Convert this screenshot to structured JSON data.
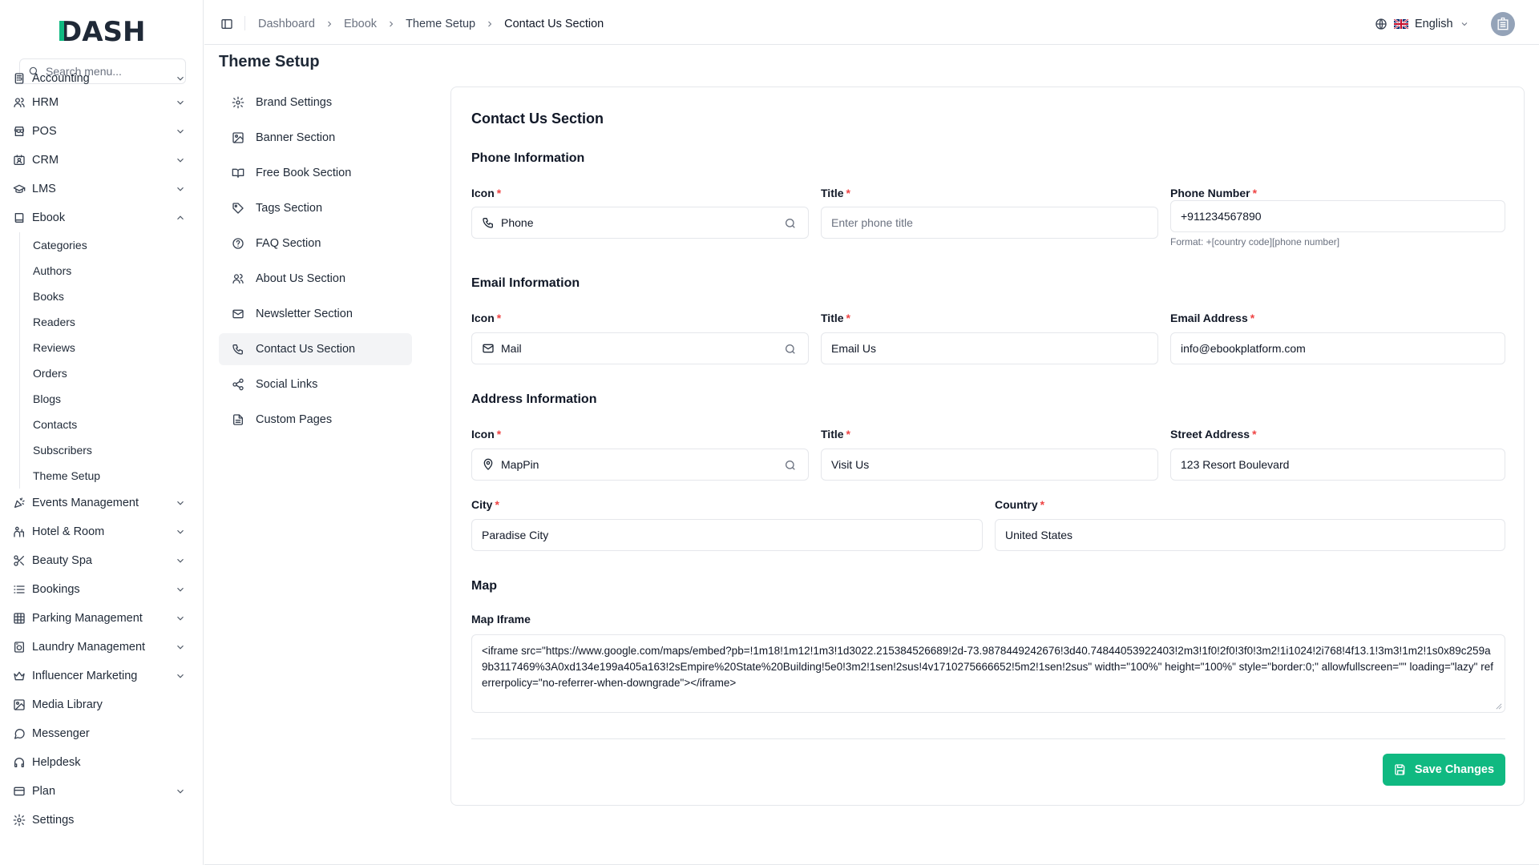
{
  "app": {
    "logo_text": "DASH"
  },
  "sidebar": {
    "search_placeholder": "Search menu...",
    "items": [
      {
        "label": "Accounting",
        "icon": "calculator-icon",
        "expandable": true
      },
      {
        "label": "HRM",
        "icon": "users-icon",
        "expandable": true
      },
      {
        "label": "POS",
        "icon": "store-icon",
        "expandable": true
      },
      {
        "label": "CRM",
        "icon": "contact-card-icon",
        "expandable": true
      },
      {
        "label": "LMS",
        "icon": "graduation-cap-icon",
        "expandable": true
      },
      {
        "label": "Ebook",
        "icon": "book-icon",
        "expandable": true,
        "expanded": true
      },
      {
        "label": "Events Management",
        "icon": "party-popper-icon",
        "expandable": true
      },
      {
        "label": "Hotel & Room",
        "icon": "hotel-icon",
        "expandable": true
      },
      {
        "label": "Beauty Spa",
        "icon": "scissors-icon",
        "expandable": true
      },
      {
        "label": "Bookings",
        "icon": "list-icon",
        "expandable": true
      },
      {
        "label": "Parking Management",
        "icon": "grid-icon",
        "expandable": true
      },
      {
        "label": "Laundry Management",
        "icon": "washing-machine-icon",
        "expandable": true
      },
      {
        "label": "Influencer Marketing",
        "icon": "crown-icon",
        "expandable": true
      },
      {
        "label": "Media Library",
        "icon": "image-icon",
        "expandable": false
      },
      {
        "label": "Messenger",
        "icon": "message-circle-icon",
        "expandable": false
      },
      {
        "label": "Helpdesk",
        "icon": "headphones-icon",
        "expandable": false
      },
      {
        "label": "Plan",
        "icon": "credit-card-icon",
        "expandable": true
      },
      {
        "label": "Settings",
        "icon": "gear-icon",
        "expandable": false
      }
    ],
    "ebook_subitems": [
      "Categories",
      "Authors",
      "Books",
      "Readers",
      "Reviews",
      "Orders",
      "Blogs",
      "Contacts",
      "Subscribers",
      "Theme Setup"
    ]
  },
  "header": {
    "breadcrumb": [
      "Dashboard",
      "Ebook",
      "Theme Setup",
      "Contact Us Section"
    ],
    "language": "English"
  },
  "page": {
    "title": "Theme Setup",
    "nav": [
      {
        "label": "Brand Settings",
        "icon": "gear-icon"
      },
      {
        "label": "Banner Section",
        "icon": "image-icon"
      },
      {
        "label": "Free Book Section",
        "icon": "book-open-icon"
      },
      {
        "label": "Tags Section",
        "icon": "tag-icon"
      },
      {
        "label": "FAQ Section",
        "icon": "help-circle-icon"
      },
      {
        "label": "About Us Section",
        "icon": "users-icon"
      },
      {
        "label": "Newsletter Section",
        "icon": "mail-icon"
      },
      {
        "label": "Contact Us Section",
        "icon": "phone-icon",
        "active": true
      },
      {
        "label": "Social Links",
        "icon": "share-icon"
      },
      {
        "label": "Custom Pages",
        "icon": "file-text-icon"
      }
    ]
  },
  "form": {
    "title": "Contact Us Section",
    "phone": {
      "heading": "Phone Information",
      "icon_label": "Icon",
      "icon_value": "Phone",
      "title_label": "Title",
      "title_placeholder": "Enter phone title",
      "number_label": "Phone Number",
      "number_value": "+911234567890",
      "number_hint": "Format: +[country code][phone number]"
    },
    "email": {
      "heading": "Email Information",
      "icon_label": "Icon",
      "icon_value": "Mail",
      "title_label": "Title",
      "title_value": "Email Us",
      "address_label": "Email Address",
      "address_value": "info@ebookplatform.com"
    },
    "address": {
      "heading": "Address Information",
      "icon_label": "Icon",
      "icon_value": "MapPin",
      "title_label": "Title",
      "title_value": "Visit Us",
      "street_label": "Street Address",
      "street_value": "123 Resort Boulevard",
      "city_label": "City",
      "city_value": "Paradise City",
      "country_label": "Country",
      "country_value": "United States"
    },
    "map": {
      "heading": "Map",
      "iframe_label": "Map Iframe",
      "iframe_value": "<iframe src=\"https://www.google.com/maps/embed?pb=!1m18!1m12!1m3!1d3022.215384526689!2d-73.9878449242676!3d40.74844053922403!2m3!1f0!2f0!3f0!3m2!1i1024!2i768!4f13.1!3m3!1m2!1s0x89c259a9b3117469%3A0xd134e199a405a163!2sEmpire%20State%20Building!5e0!3m2!1sen!2sus!4v1710275666652!5m2!1sen!2sus\" width=\"100%\" height=\"100%\" style=\"border:0;\" allowfullscreen=\"\" loading=\"lazy\" referrerpolicy=\"no-referrer-when-downgrade\"></iframe>"
    },
    "save_label": "Save Changes"
  },
  "colors": {
    "accent": "#10b981",
    "required": "#ef4444",
    "active_nav_bg": "#f3f4f6",
    "border": "#e5e7eb"
  }
}
